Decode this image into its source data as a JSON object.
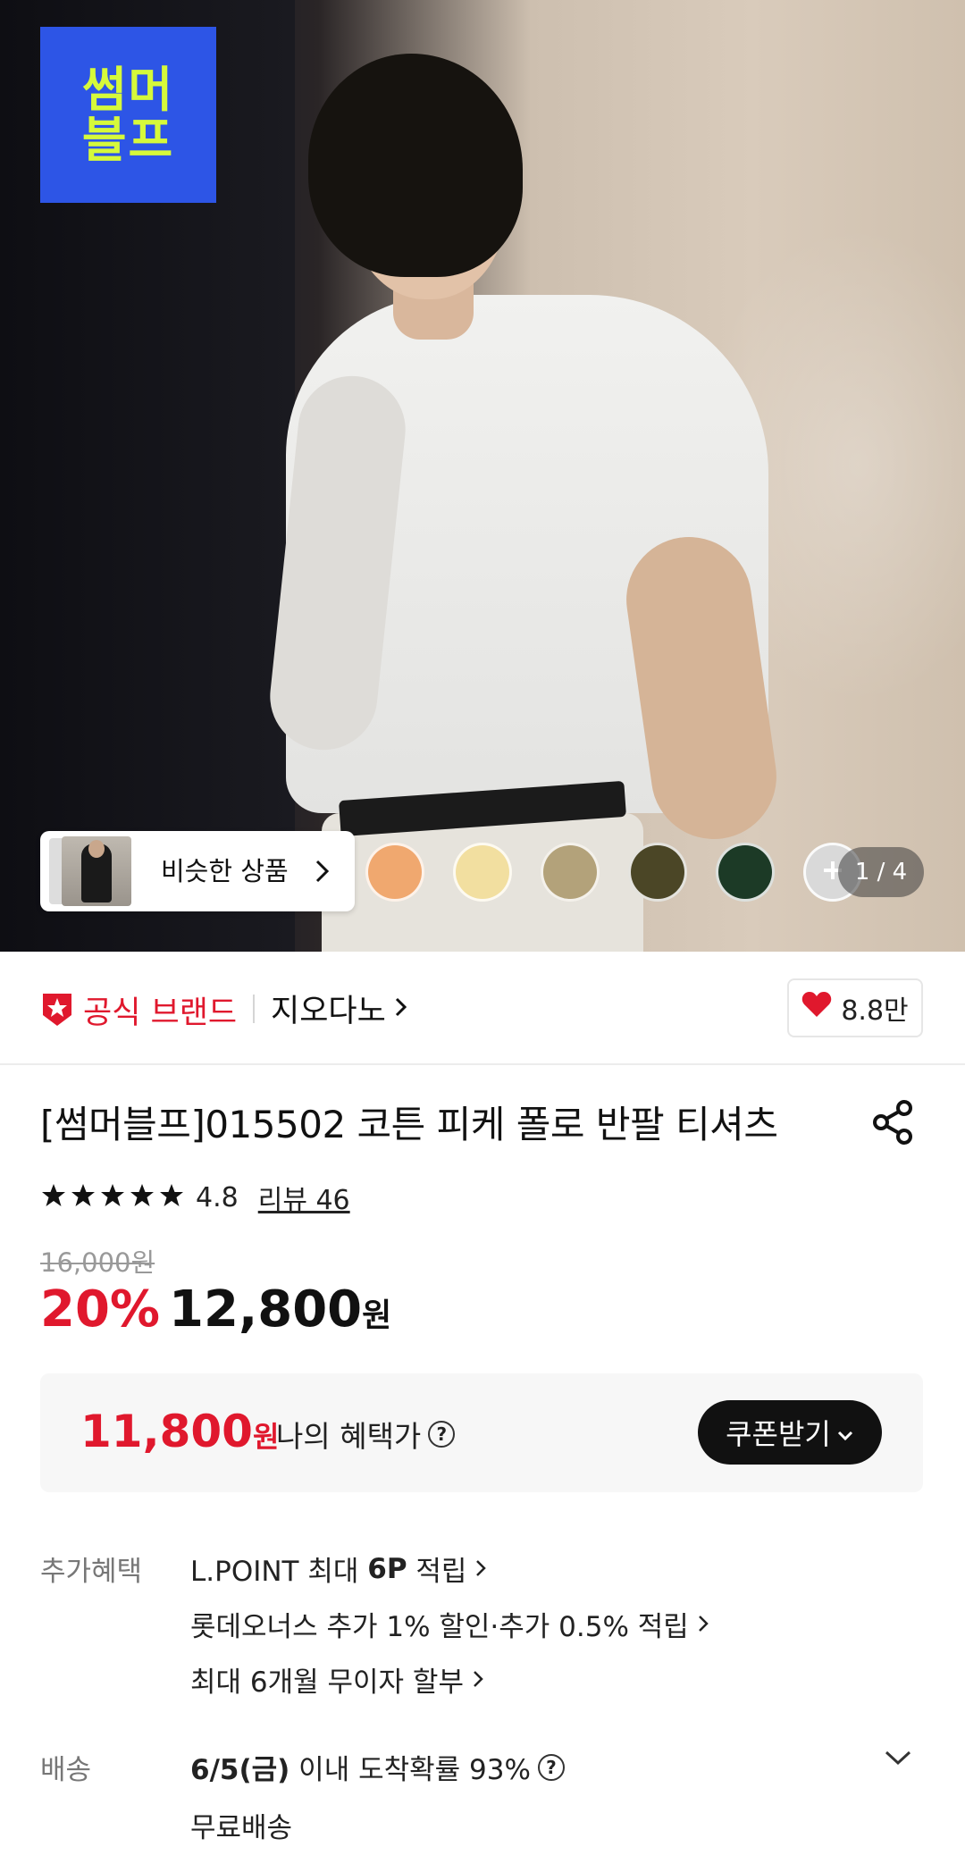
{
  "hero": {
    "promo_logo": {
      "line1": "썸머",
      "line2": "블프"
    },
    "similar_label": "비슷한 상품",
    "swatches": [
      "#f0a86f",
      "#f2dfa0",
      "#b3a27a",
      "#4b4626",
      "#1c3a26",
      "#d9d9d9"
    ],
    "counter": "1 / 4"
  },
  "brand": {
    "official_label": "공식 브랜드",
    "brand_name": "지오다노",
    "like_count": "8.8만"
  },
  "product": {
    "title": "[썸머블프]015502 코튼 피케 폴로 반팔 티셔츠",
    "rating": "4.8",
    "review": "리뷰 46",
    "original_price": "16,000원",
    "discount": "20%",
    "price": "12,800",
    "price_unit": "원"
  },
  "benefit": {
    "price": "11,800",
    "unit": "원",
    "label": "나의 혜택가",
    "coupon": "쿠폰받기"
  },
  "extra": {
    "label": "추가혜택",
    "line1_pre": "L.POINT 최대 ",
    "line1_bold": "6P",
    "line1_post": " 적립",
    "line2": "롯데오너스 추가 1% 할인·추가 0.5% 적립",
    "line3": "최대 6개월 무이자 할부"
  },
  "delivery": {
    "label": "배송",
    "date_bold": "6/5(금)",
    "date_rest": " 이내 도착확률 93%",
    "fee": "무료배송"
  },
  "colors": {
    "accent": "#e0182d",
    "promo_bg": "#2d55e6",
    "promo_text": "#d6f93a"
  }
}
